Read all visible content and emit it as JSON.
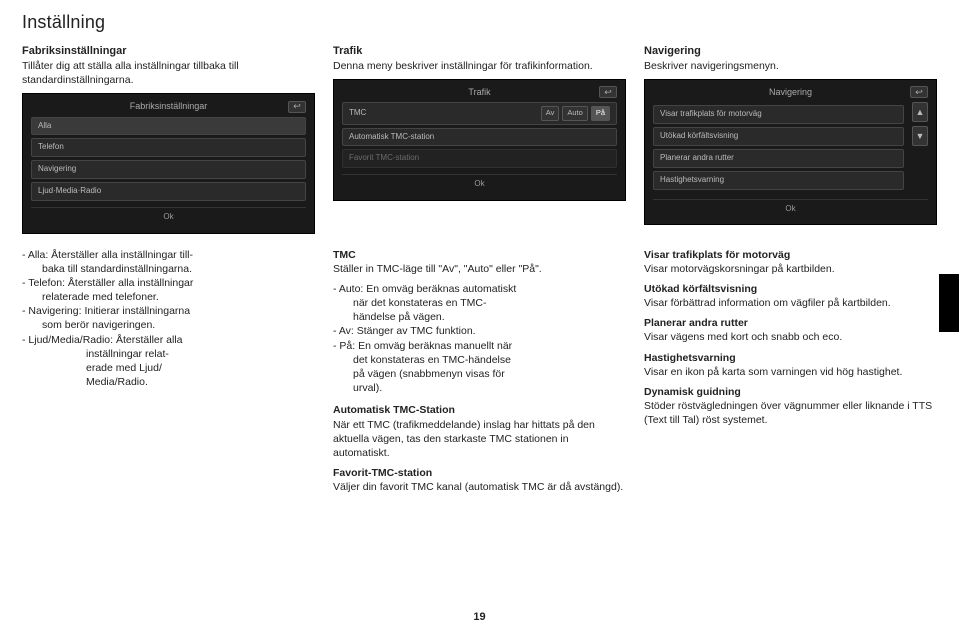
{
  "page_title": "Inställning",
  "page_number": "19",
  "top": {
    "col1": {
      "head": "Fabriksinställningar",
      "desc": "Tillåter dig att ställa alla inställningar tillbaka till standardinställningarna.",
      "device": {
        "title": "Fabriksinställningar",
        "rows": [
          "Alla",
          "Telefon",
          "Navigering",
          "Ljud·Media·Radio"
        ],
        "ok": "Ok"
      }
    },
    "col2": {
      "head": "Trafik",
      "desc": "Denna meny beskriver inställningar för trafikinformation.",
      "device": {
        "title": "Trafik",
        "tmc_label": "TMC",
        "tmc_opts": [
          "Av",
          "Auto",
          "På"
        ],
        "rows": [
          "Automatisk TMC-station",
          "Favorit TMC-station"
        ],
        "ok": "Ok"
      }
    },
    "col3": {
      "head": "Navigering",
      "desc": "Beskriver navigeringsmenyn.",
      "device": {
        "title": "Navigering",
        "rows": [
          "Visar trafikplats för motorväg",
          "Utökad körfältsvisning",
          "Planerar andra rutter",
          "Hastighetsvarning"
        ],
        "ok": "Ok"
      }
    }
  },
  "bottom": {
    "col1": {
      "l1a": "- Alla: Återställer alla inställningar till-",
      "l1b": "baka till standardinställningarna.",
      "l2a": "- Telefon: Återställer alla inställningar",
      "l2b": "relaterade med telefoner.",
      "l3a": "- Navigering: Initierar inställningarna",
      "l3b": "som berör navigeringen.",
      "l4a": "- Ljud/Media/Radio: Återställer alla",
      "l4b": "inställningar relat-",
      "l4c": "erade med Ljud/",
      "l4d": "Media/Radio."
    },
    "col2": {
      "h1": "TMC",
      "p1": "Ställer in TMC-läge till \"Av\", \"Auto\" eller \"På\".",
      "p2a": "- Auto: En omväg beräknas automatiskt",
      "p2b": "när det konstateras en TMC-",
      "p2c": "händelse på vägen.",
      "p3": "- Av: Stänger av TMC funktion.",
      "p4a": "- På: En omväg beräknas manuellt när",
      "p4b": "det konstateras en TMC-händelse",
      "p4c": "på vägen (snabbmenyn visas för",
      "p4d": "urval).",
      "h2": "Automatisk TMC-Station",
      "p5": "När ett TMC (trafikmeddelande) inslag har hittats på den aktuella vägen, tas den starkaste TMC stationen in automatiskt.",
      "h3": "Favorit-TMC-station",
      "p6": "Väljer din favorit TMC kanal (automatisk TMC är då avstängd)."
    },
    "col3": {
      "h1": "Visar trafikplats för motorväg",
      "p1": "Visar motorvägskorsningar på kartbilden.",
      "h2": "Utökad körfältsvisning",
      "p2": "Visar förbättrad information om vägfiler på kartbilden.",
      "h3": "Planerar andra rutter",
      "p3": "Visar vägens med kort och snabb och eco.",
      "h4": "Hastighetsvarning",
      "p4": "Visar en ikon på karta som varningen vid hög hastighet.",
      "h5": "Dynamisk guidning",
      "p5": "Stöder röstvägledningen över vägnummer eller liknande i TTS (Text till Tal) röst systemet."
    }
  }
}
